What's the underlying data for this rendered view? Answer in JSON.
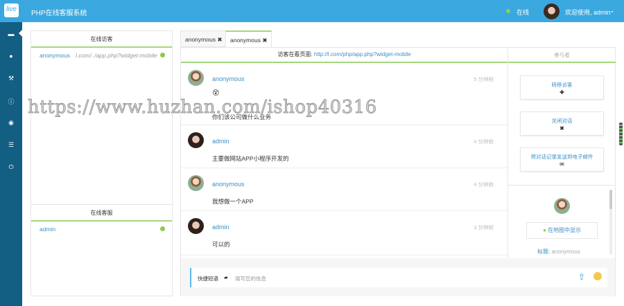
{
  "header": {
    "logo": "live",
    "title": "PHP在线客服系统",
    "status": "在线",
    "welcome": "欢迎使用, admin"
  },
  "sidebar": {
    "icons": [
      "comment-icon",
      "map-marker-icon",
      "wrench-icon",
      "info-icon",
      "eye-icon",
      "list-icon",
      "power-icon"
    ]
  },
  "visitors": {
    "title": "在线访客",
    "items": [
      {
        "name": "anonymous",
        "url": "l.com/../app.php?widget-mobile"
      }
    ]
  },
  "agents": {
    "title": "在线客服",
    "items": [
      {
        "name": "admin"
      }
    ]
  },
  "tabs": [
    {
      "label": "anonymous"
    },
    {
      "label": "anonymous"
    }
  ],
  "chat": {
    "visiting_label": "访客在看页面:",
    "visiting_url": "http://l.com/php/app.php?widget-mobile",
    "messages": [
      {
        "name": "anonymous",
        "time": "5 分钟前",
        "emoji": "😵",
        "text": "你们该公司做什么业务"
      },
      {
        "name": "admin",
        "time": "4 分钟前",
        "text": "主要做网站APP小程序开发的"
      },
      {
        "name": "anonymous",
        "time": "4 分钟前",
        "text": "我想做一个APP"
      },
      {
        "name": "admin",
        "time": "3 分钟前",
        "text": "可以的"
      }
    ]
  },
  "participants": {
    "title": "参与者",
    "transfer": "转移访客",
    "close": "关闭对话",
    "email": "将对话记录发送到电子邮件",
    "map": "在地图中显示",
    "title_label": "标题:",
    "title_value": "anonymous"
  },
  "input": {
    "quick": "快捷短语",
    "placeholder": "填写您的信息"
  },
  "watermark": "https://www.huzhan.com/ishop40316",
  "colors": {
    "header": "#3aa8de",
    "sidebar": "#135e83",
    "accent_green": "#a5d67c",
    "link": "#3d8fc4"
  }
}
